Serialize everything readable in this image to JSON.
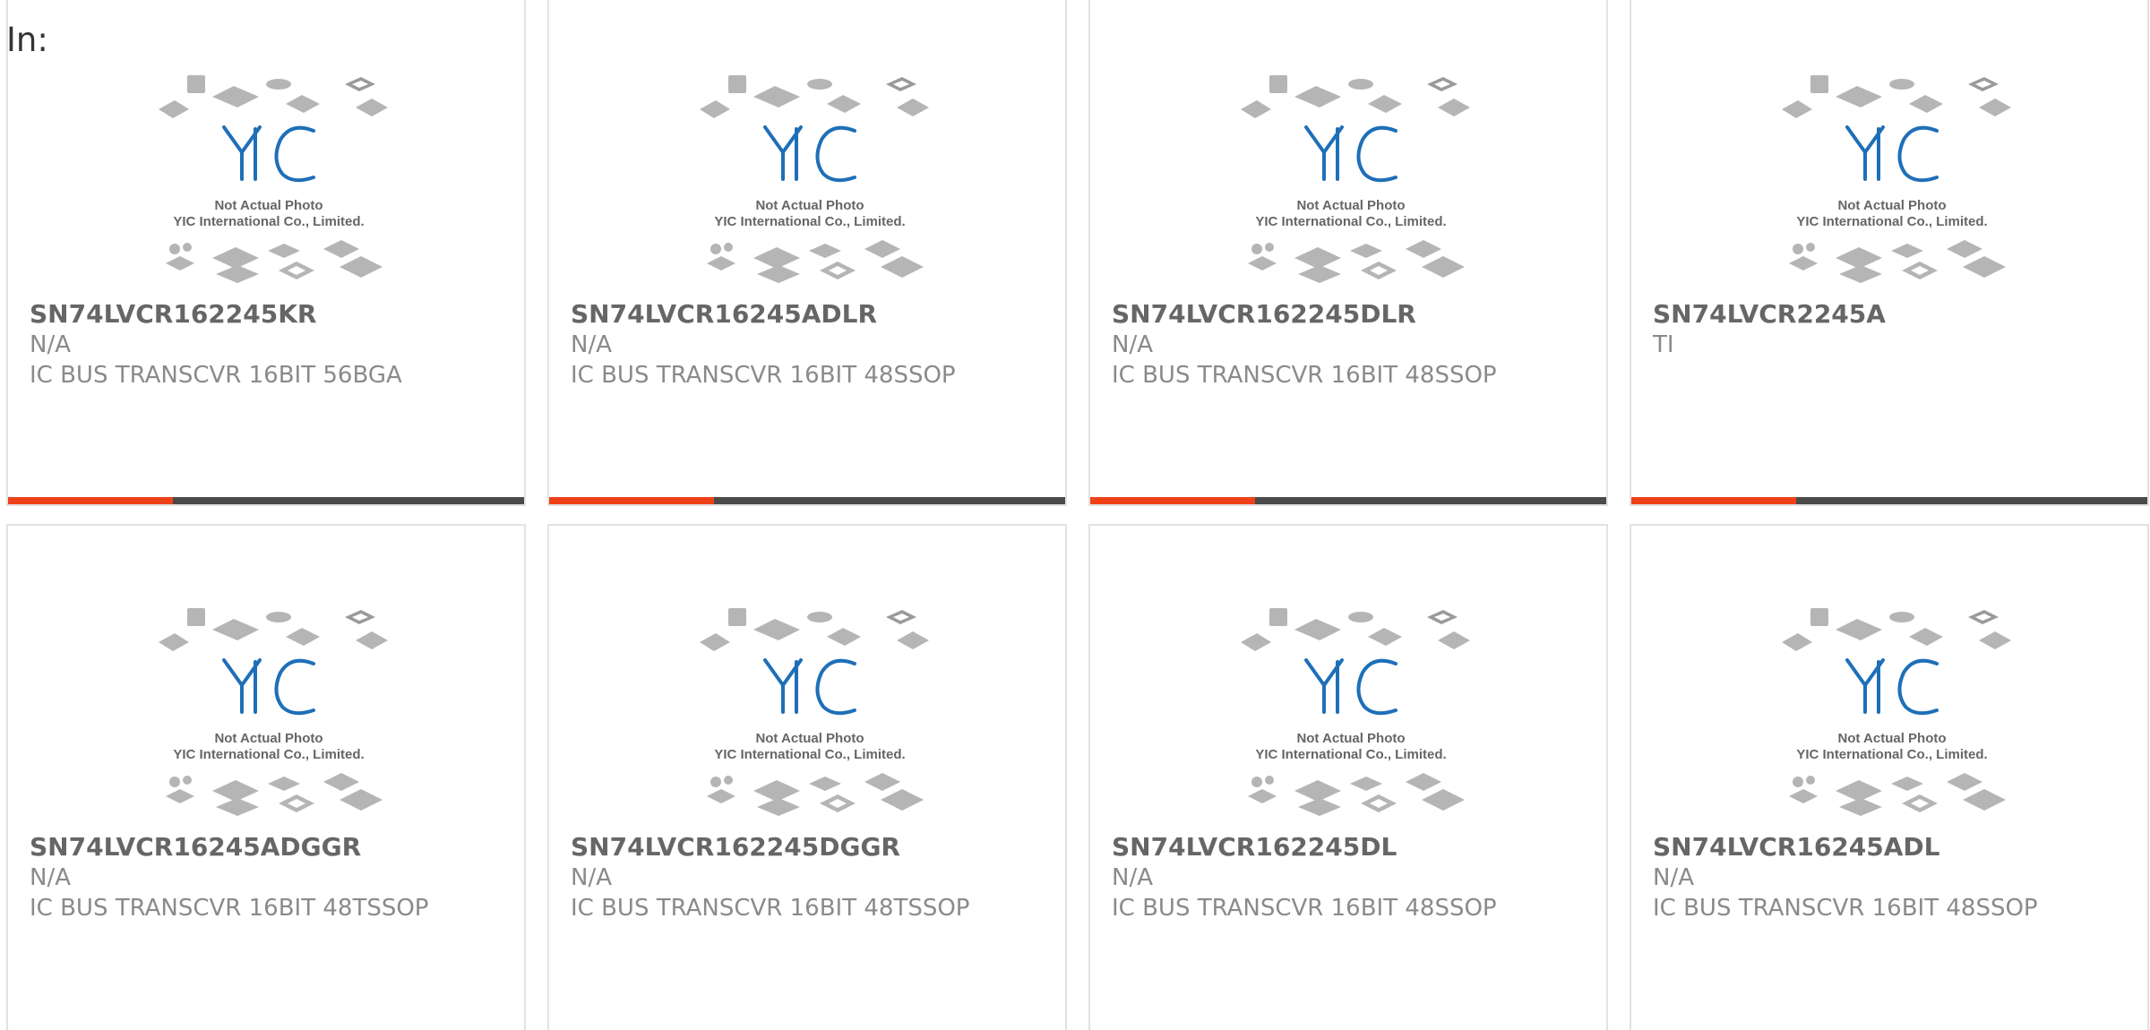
{
  "page": {
    "in_label": "In:"
  },
  "image": {
    "caption_line1": "Not Actual Photo",
    "caption_line2": "YIC International Co., Limited.",
    "logo_text": "YIC"
  },
  "colors": {
    "accent": "#ee4117",
    "bar": "#4a4a4a",
    "logo_blue": "#1e6fb8",
    "chip_gray": "#b5b5b5"
  },
  "accent_bar_fraction": 0.32,
  "products": [
    {
      "part": "SN74LVCR162245KR",
      "manufacturer": "N/A",
      "description": "IC BUS TRANSCVR 16BIT 56BGA"
    },
    {
      "part": "SN74LVCR16245ADLR",
      "manufacturer": "N/A",
      "description": "IC BUS TRANSCVR 16BIT 48SSOP"
    },
    {
      "part": "SN74LVCR162245DLR",
      "manufacturer": "N/A",
      "description": "IC BUS TRANSCVR 16BIT 48SSOP"
    },
    {
      "part": "SN74LVCR2245A",
      "manufacturer": "TI",
      "description": ""
    },
    {
      "part": "SN74LVCR16245ADGGR",
      "manufacturer": "N/A",
      "description": "IC BUS TRANSCVR 16BIT 48TSSOP"
    },
    {
      "part": "SN74LVCR162245DGGR",
      "manufacturer": "N/A",
      "description": "IC BUS TRANSCVR 16BIT 48TSSOP"
    },
    {
      "part": "SN74LVCR162245DL",
      "manufacturer": "N/A",
      "description": "IC BUS TRANSCVR 16BIT 48SSOP"
    },
    {
      "part": "SN74LVCR16245ADL",
      "manufacturer": "N/A",
      "description": "IC BUS TRANSCVR 16BIT 48SSOP"
    }
  ]
}
